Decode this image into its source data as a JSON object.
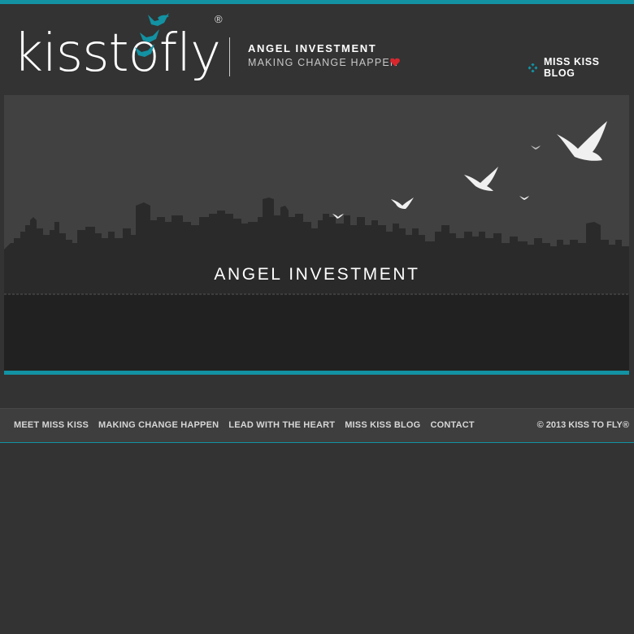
{
  "header": {
    "logo_text": "kisstofly",
    "logo_registered": "®",
    "tagline_1": "ANGEL INVESTMENT",
    "tagline_2": "MAKING CHANGE HAPPEN",
    "blog_link": "MISS KISS BLOG"
  },
  "hero": {
    "title": "ANGEL INVESTMENT"
  },
  "footer": {
    "nav": [
      {
        "label": "MEET MISS KISS"
      },
      {
        "label": "MAKING CHANGE HAPPEN"
      },
      {
        "label": "LEAD WITH THE HEART"
      },
      {
        "label": "MISS KISS BLOG"
      },
      {
        "label": "CONTACT"
      }
    ],
    "copyright": "© 2013 KISS TO FLY®"
  },
  "colors": {
    "accent": "#1292a3",
    "heart": "#d9262c",
    "background": "#333333",
    "sky": "#414141",
    "skyline": "#2a2a2a",
    "ground": "#212121"
  },
  "icons": [
    "logo-bird-icon",
    "heart-icon",
    "diamonds-icon",
    "bird-icon"
  ]
}
